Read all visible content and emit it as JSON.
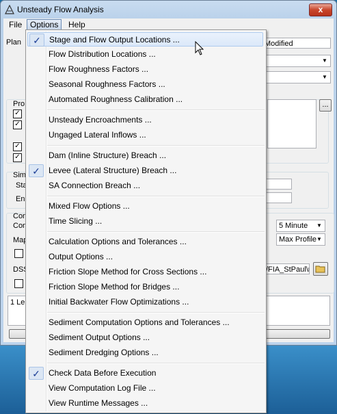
{
  "window": {
    "title": "Unsteady Flow Analysis",
    "close_label": "x"
  },
  "menubar": {
    "items": [
      "File",
      "Options",
      "Help"
    ]
  },
  "form": {
    "plan_label": "Plan",
    "plan_value": "Modified",
    "programs_label": "Pro",
    "simulation_label": "Sim",
    "start_label": "Sta",
    "end_label": "En",
    "computation_label": "Con",
    "computation_label_2": "Con",
    "mapping_label": "Map",
    "dss_label": "DSS",
    "dss_value": "/FIA_StPaul\\r",
    "interval_value": "5 Minute",
    "profile_value": "Max Profile",
    "log_text": "1 Le",
    "browse_label": "..."
  },
  "options_menu": {
    "items": [
      {
        "label": "Stage and Flow Output Locations ...",
        "checked": true,
        "highlighted": true
      },
      {
        "label": "Flow Distribution Locations ...",
        "checked": false
      },
      {
        "label": "Flow Roughness Factors ...",
        "checked": false
      },
      {
        "label": "Seasonal Roughness Factors ...",
        "checked": false
      },
      {
        "label": "Automated Roughness Calibration ...",
        "checked": false
      },
      {
        "separator": true
      },
      {
        "label": "Unsteady Encroachments ...",
        "checked": false
      },
      {
        "label": "Ungaged Lateral Inflows ...",
        "checked": false
      },
      {
        "separator": true
      },
      {
        "label": "Dam (Inline Structure) Breach ...",
        "checked": false
      },
      {
        "label": "Levee (Lateral Structure) Breach ...",
        "checked": true
      },
      {
        "label": "SA Connection Breach ...",
        "checked": false
      },
      {
        "separator": true
      },
      {
        "label": "Mixed Flow Options ...",
        "checked": false
      },
      {
        "label": "Time Slicing ...",
        "checked": false
      },
      {
        "separator": true
      },
      {
        "label": "Calculation Options and Tolerances ...",
        "checked": false
      },
      {
        "label": "Output Options ...",
        "checked": false
      },
      {
        "label": "Friction Slope Method for Cross Sections ...",
        "checked": false
      },
      {
        "label": "Friction Slope Method for Bridges ...",
        "checked": false
      },
      {
        "label": "Initial Backwater Flow Optimizations ...",
        "checked": false
      },
      {
        "separator": true
      },
      {
        "label": "Sediment Computation Options and Tolerances ...",
        "checked": false
      },
      {
        "label": "Sediment Output Options ...",
        "checked": false
      },
      {
        "label": "Sediment Dredging Options ...",
        "checked": false
      },
      {
        "separator": true
      },
      {
        "label": "Check Data Before Execution",
        "checked": true
      },
      {
        "label": "View Computation Log File ...",
        "checked": false
      },
      {
        "label": "View Runtime Messages ...",
        "checked": false
      }
    ]
  }
}
